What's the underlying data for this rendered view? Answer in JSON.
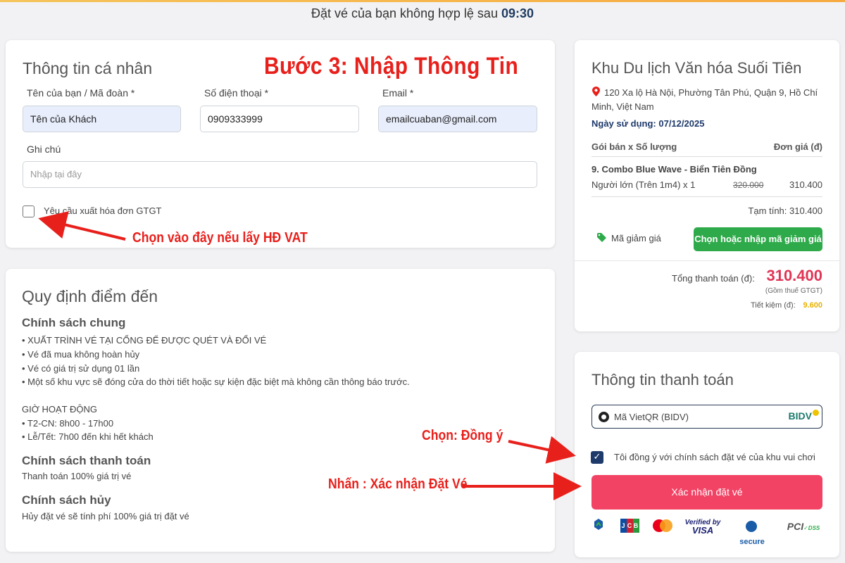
{
  "header": {
    "expiry_text": "Đặt vé của bạn không hợp lệ sau",
    "timer": "09:30"
  },
  "annotations": {
    "step": "Bước 3: Nhập Thông Tin",
    "vat_hint": "Chọn vào đây nếu lấy HĐ VAT",
    "agree_hint": "Chọn: Đồng ý",
    "confirm_hint": "Nhấn : Xác nhận Đặt Vé"
  },
  "personal": {
    "title": "Thông tin cá nhân",
    "name_label": "Tên của bạn / Mã đoàn *",
    "name_value": "Tên của Khách",
    "phone_label": "Số điện thoại *",
    "phone_value": "0909333999",
    "email_label": "Email *",
    "email_value": "emailcuaban@gmail.com",
    "note_label": "Ghi chú",
    "note_placeholder": "Nhập tại đây",
    "vat_label": "Yêu cầu xuất hóa đơn GTGT"
  },
  "rules": {
    "title": "Quy định điểm đến",
    "general_heading": "Chính sách chung",
    "general_items": [
      "• XUẤT TRÌNH VÉ TẠI CỔNG ĐỂ ĐƯỢC QUÉT VÀ ĐỔI VÉ",
      "• Vé đã mua không hoàn hủy",
      "• Vé có giá trị sử dụng 01 lần",
      "• Một số khu vực sẽ đóng cửa do thời tiết hoặc sự kiện đặc biệt mà không cần thông báo trước."
    ],
    "hours_heading": "GIỜ HOẠT ĐỘNG",
    "hours_items": [
      "• T2-CN: 8h00 - 17h00",
      "• Lễ/Tết: 7h00 đến khi hết khách"
    ],
    "payment_heading": "Chính sách thanh toán",
    "payment_text": "Thanh toán 100% giá trị vé",
    "cancel_heading": "Chính sách hủy",
    "cancel_text": "Hủy đặt vé sẽ tính phí 100% giá trị đặt vé"
  },
  "summary": {
    "title": "Khu Du lịch Văn hóa Suối Tiên",
    "address_line1": "120 Xa lộ Hà Nội, Phường Tân Phú, Quận 9, Hồ Chí",
    "address_line2": "Minh, Việt Nam",
    "usage_date": "Ngày sử dụng: 07/12/2025",
    "col_package": "Gói bán x Số lượng",
    "col_price": "Đơn giá (đ)",
    "package_name": "9. Combo Blue Wave - Biển Tiên Đồng",
    "ticket_type": "Người lớn (Trên 1m4) x 1",
    "old_price": "320.000",
    "price": "310.400",
    "subtotal": "Tạm tính: 310.400",
    "discount_label": "Mã giảm giá",
    "discount_button": "Chọn hoặc nhập mã giảm giá",
    "total_label": "Tổng thanh toán (đ):",
    "total_value": "310.400",
    "vat_note": "(Gồm thuế GTGT)",
    "savings_label": "Tiết kiệm (đ):",
    "savings_value": "9.600"
  },
  "payment": {
    "title": "Thông tin thanh toán",
    "method": "Mã VietQR (BIDV)",
    "bank_logo": "BIDV",
    "agree_text": "Tôi đồng ý với chính sách đặt vé của khu vui chơi",
    "confirm_button": "Xác nhận đặt vé",
    "logos": [
      "JCB",
      "Verified by VISA",
      "secure",
      "PCI DSS"
    ]
  },
  "colors": {
    "primary": "#f24365",
    "green": "#2eaa4a",
    "total_red": "#e03555",
    "annotation_red": "#e8201c",
    "navy": "#1e3a6b"
  }
}
